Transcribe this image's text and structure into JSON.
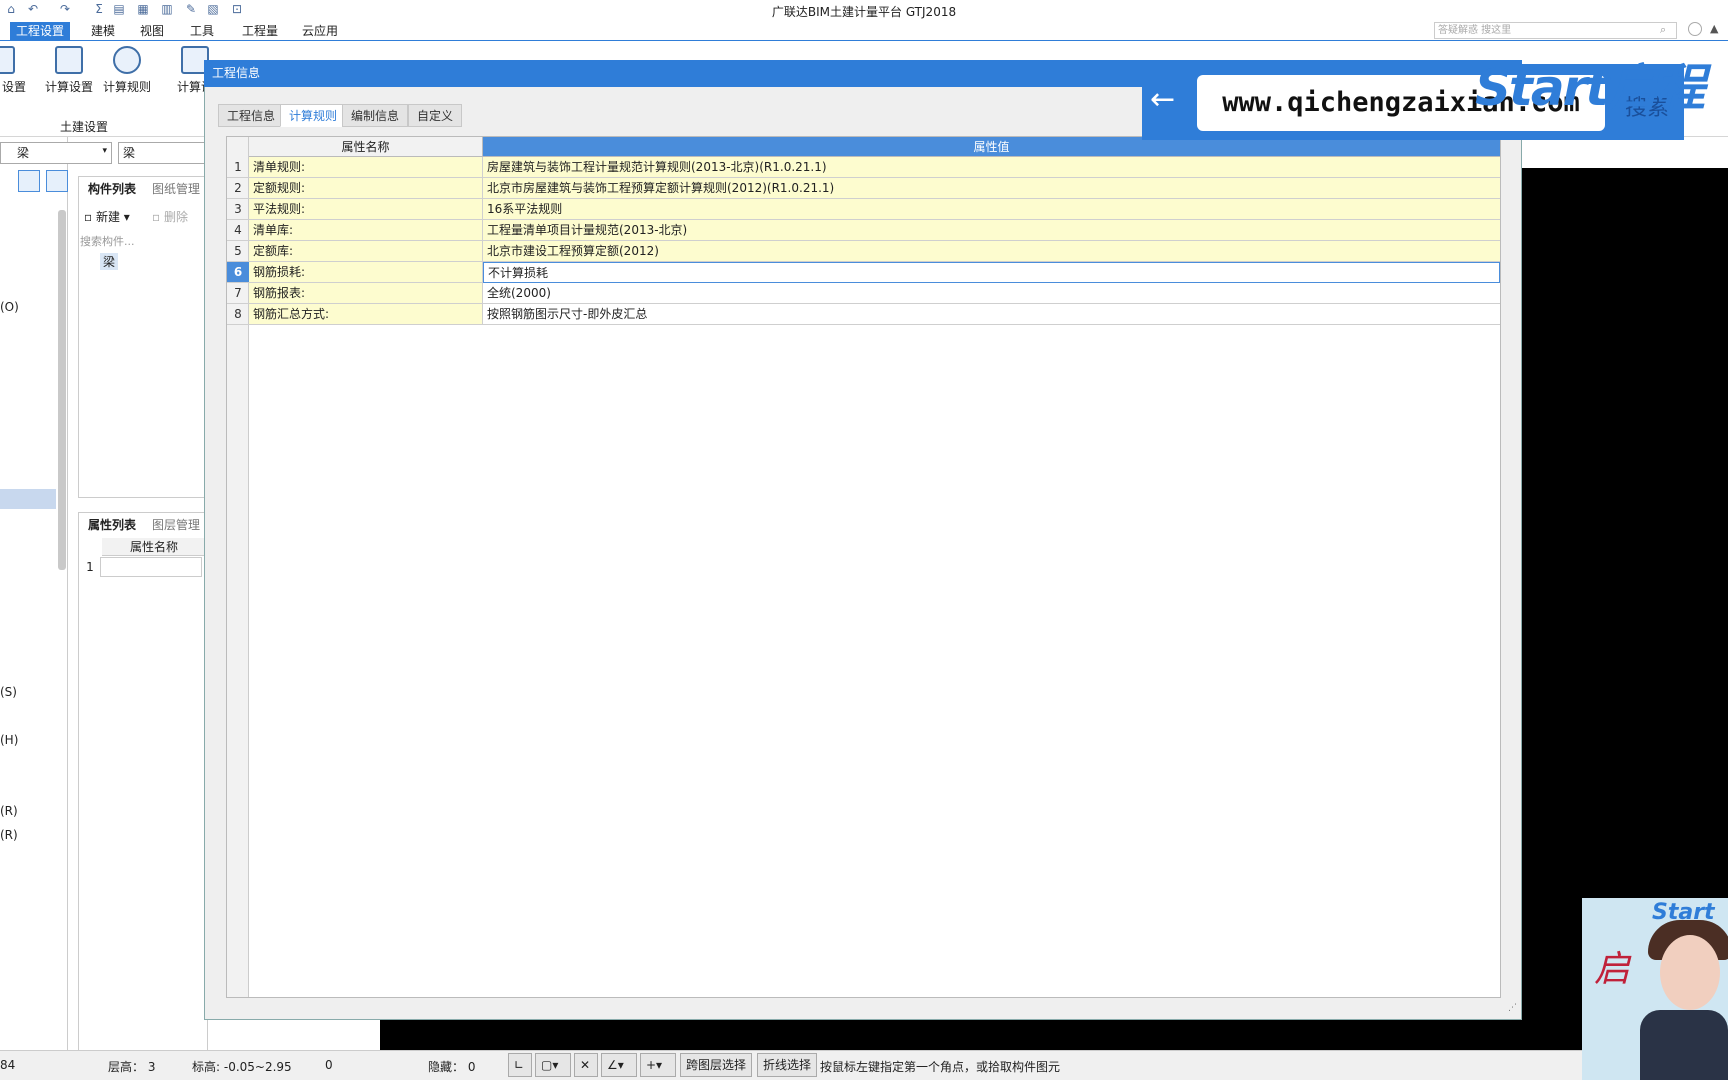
{
  "app_title": "广联达BIM土建计量平台 GTJ2018",
  "top_search_placeholder": "答疑解惑   搜这里",
  "menu": [
    "工程设置",
    "建模",
    "视图",
    "工具",
    "工程量",
    "云应用"
  ],
  "ribbon": {
    "left_clip": "设置",
    "buttons": [
      "计算设置",
      "计算规则"
    ],
    "clip_btn": "计算设",
    "group_label": "土建设置"
  },
  "left_panel": {
    "dd1": "梁",
    "dd2": "梁",
    "tabs_top": [
      "构件列表",
      "图纸管理"
    ],
    "new_label": "新建",
    "delete_label": "删除",
    "search_placeholder": "搜索构件...",
    "tree_item": "梁",
    "tabs_bottom": [
      "属性列表",
      "图层管理"
    ],
    "prop_header": "属性名称",
    "prop_row": "1",
    "edge_labels": [
      "(O)",
      "(S)",
      "(H)",
      "(R)",
      "(R)"
    ]
  },
  "dialog": {
    "title": "工程信息",
    "tabs": [
      "工程信息",
      "计算规则",
      "编制信息",
      "自定义"
    ],
    "selected_tab": 1,
    "col_name": "属性名称",
    "col_value": "属性值",
    "rows": [
      {
        "n": "1",
        "name": "清单规则:",
        "value": "房屋建筑与装饰工程计量规范计算规则(2013-北京)(R1.0.21.1)"
      },
      {
        "n": "2",
        "name": "定额规则:",
        "value": "北京市房屋建筑与装饰工程预算定额计算规则(2012)(R1.0.21.1)"
      },
      {
        "n": "3",
        "name": "平法规则:",
        "value": "16系平法规则"
      },
      {
        "n": "4",
        "name": "清单库:",
        "value": "工程量清单项目计量规范(2013-北京)"
      },
      {
        "n": "5",
        "name": "定额库:",
        "value": "北京市建设工程预算定额(2012)"
      },
      {
        "n": "6",
        "name": "钢筋损耗:",
        "value": "不计算损耗"
      },
      {
        "n": "7",
        "name": "钢筋报表:",
        "value": "全统(2000)"
      },
      {
        "n": "8",
        "name": "钢筋汇总方式:",
        "value": "按照钢筋图示尺寸-即外皮汇总"
      }
    ]
  },
  "watermark": {
    "url": "www.qichengzaixian.com",
    "search": "搜索",
    "logo": "Start启程",
    "cam_logo": "Start启",
    "cam_char": "启"
  },
  "status": {
    "left_num": "84",
    "floor_height": "层高： 3",
    "elevation": "标高: -0.05~2.95",
    "zero": "0",
    "hidden": "隐藏： 0",
    "btn_cross_floor": "跨图层选择",
    "btn_polyline": "折线选择",
    "hint": "按鼠标左键指定第一个角点，或拾取构件图元"
  },
  "colors": {
    "accent": "#2f7dd8",
    "row_yellow": "#fdfccf",
    "canvas": "#000000"
  }
}
